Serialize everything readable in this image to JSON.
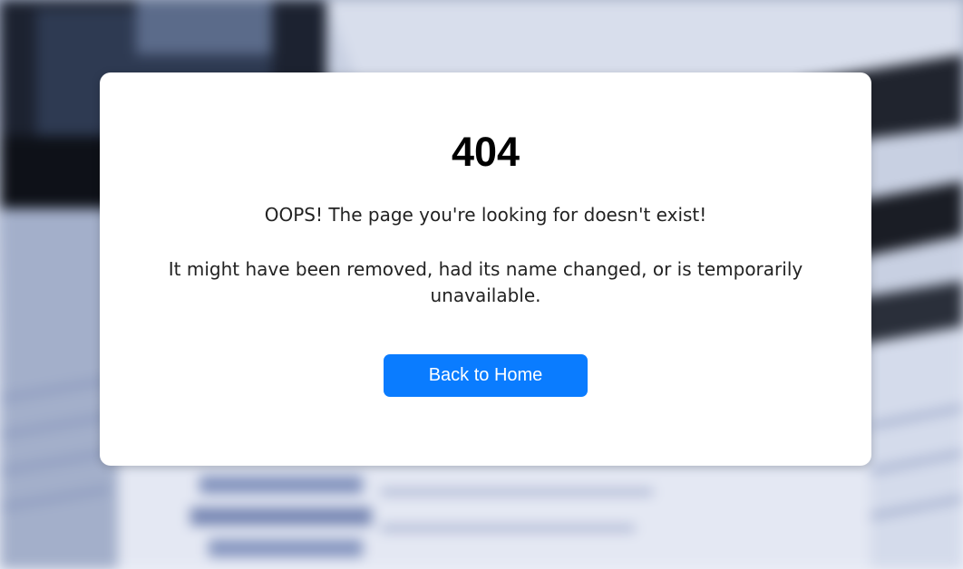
{
  "error": {
    "code": "404",
    "message": "OOPS! The page you're looking for doesn't exist!",
    "details": "It might have been removed, had its name changed, or is temporarily unavailable.",
    "button_label": "Back to Home"
  },
  "colors": {
    "button_background": "#0a7cff",
    "button_text": "#ffffff",
    "card_background": "#ffffff",
    "heading_text": "#000000"
  }
}
